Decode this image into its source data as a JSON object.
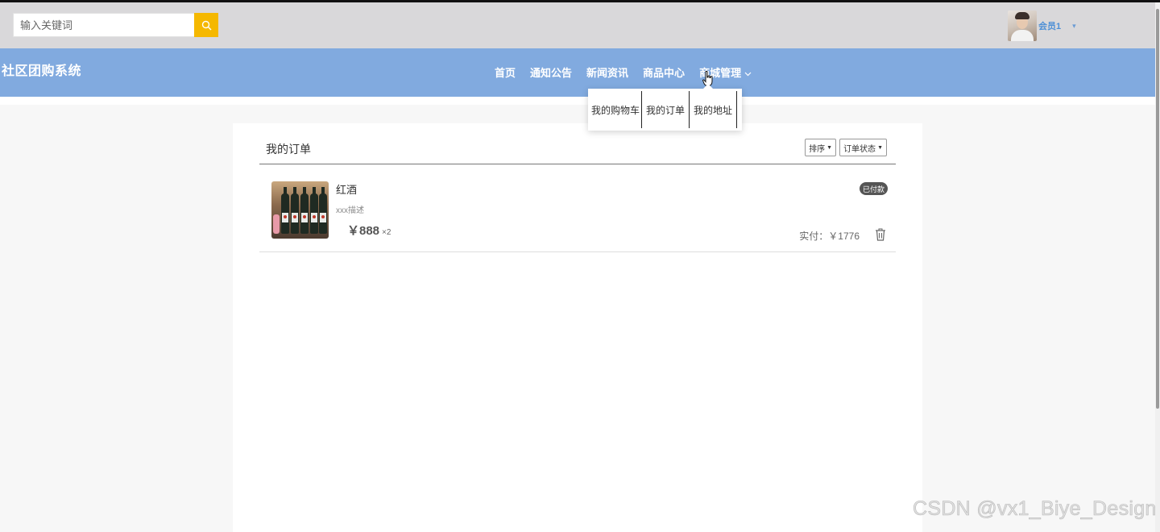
{
  "header": {
    "search": {
      "placeholder": "输入关键词",
      "value": ""
    },
    "user": {
      "name": "会员1",
      "caret": "▾"
    }
  },
  "nav": {
    "brand": "社区团购系统",
    "items": [
      {
        "label": "首页"
      },
      {
        "label": "通知公告"
      },
      {
        "label": "新闻资讯"
      },
      {
        "label": "商品中心"
      },
      {
        "label": "商城管理"
      }
    ],
    "dropdown": [
      {
        "label": "我的购物车"
      },
      {
        "label": "我的订单"
      },
      {
        "label": "我的地址"
      }
    ]
  },
  "orders": {
    "title": "我的订单",
    "filters": [
      {
        "label": "排序"
      },
      {
        "label": "订单状态"
      }
    ],
    "items": [
      {
        "name": "红酒",
        "desc": "xxx描述",
        "price": "￥888",
        "qty": "×2",
        "status": "已付款",
        "paid": "实付：￥1776"
      }
    ]
  },
  "watermark": "CSDN @vx1_Biye_Design",
  "colors": {
    "topbar": "#d9d8da",
    "navbar": "#81aadf",
    "search_button": "#f5b800",
    "user_name": "#4d8fd6",
    "badge": "#555555"
  },
  "icons": {
    "search": "search-icon",
    "avatar": "avatar",
    "chevron": "chevron-down-icon",
    "cursor": "hand-cursor-icon",
    "trash": "trash-icon"
  }
}
